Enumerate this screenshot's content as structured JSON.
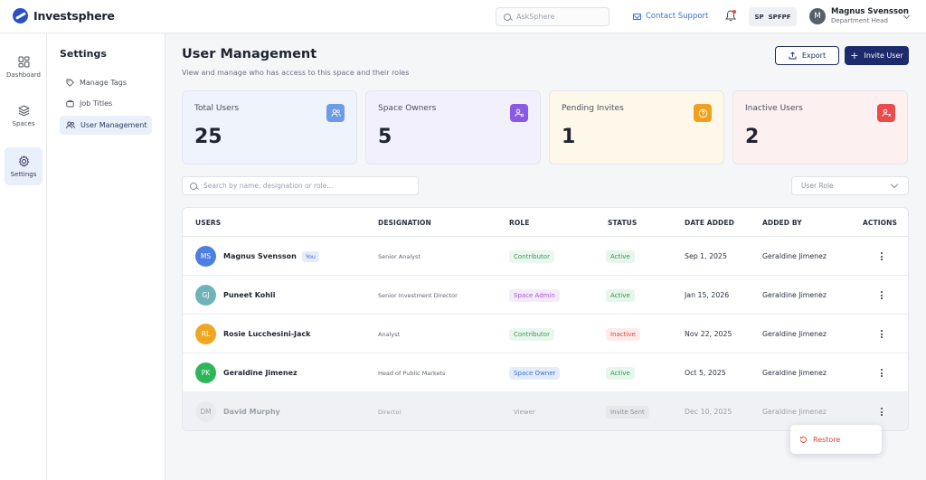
{
  "app": {
    "brand": "Investsphere",
    "ask_placeholder": "AskSphere",
    "support_label": "Contact Support",
    "workspace_initials": "SP",
    "workspace_code": "SPFPF",
    "user_initial": "M",
    "user_name": "Magnus Svensson",
    "user_role": "Department Head"
  },
  "rail": [
    {
      "label": "Dashboard",
      "icon": "grid-icon"
    },
    {
      "label": "Spaces",
      "icon": "layers-icon"
    },
    {
      "label": "Settings",
      "icon": "gear-icon",
      "active": true
    }
  ],
  "subnav": {
    "title": "Settings",
    "items": [
      {
        "label": "Manage Tags",
        "icon": "tag-icon"
      },
      {
        "label": "Job Titles",
        "icon": "briefcase-icon"
      },
      {
        "label": "User Management",
        "icon": "users-icon",
        "active": true
      }
    ]
  },
  "page": {
    "title": "User Management",
    "subtitle": "View and manage  who has access to this space and their roles",
    "export_label": "Export",
    "invite_label": "Invite User"
  },
  "stats": [
    {
      "label": "Total Users",
      "value": "25",
      "bg": "#eef3fc",
      "icon_bg": "#6e9be6",
      "icon": "users-icon"
    },
    {
      "label": "Space Owners",
      "value": "5",
      "bg": "#f3f0fd",
      "icon_bg": "#8a5ae6",
      "icon": "user-cog-icon"
    },
    {
      "label": "Pending Invites",
      "value": "1",
      "bg": "#fdf8ea",
      "icon_bg": "#f0a01f",
      "icon": "question-icon"
    },
    {
      "label": "Inactive Users",
      "value": "2",
      "bg": "#fdf0f0",
      "icon_bg": "#ea4b4b",
      "icon": "user-x-icon"
    }
  ],
  "filters": {
    "search_placeholder": "Search by name, designation or role...",
    "role_placeholder": "User Role"
  },
  "table": {
    "headers": [
      "USERS",
      "DESIGNATION",
      "ROLE",
      "STATUS",
      "DATE ADDED",
      "ADDED BY",
      "ACTIONS"
    ],
    "rows": [
      {
        "initials": "MS",
        "avatar_color": "#4d7fe0",
        "name": "Magnus Svensson",
        "you": "You",
        "designation": "Senior Analyst",
        "role": "Contributor",
        "role_bg": "#eaf7ee",
        "role_fg": "#3a9a57",
        "status": "Active",
        "status_bg": "#e6f6ea",
        "status_fg": "#2f9a4e",
        "date": "Sep 1, 2025",
        "added_by": "Geraldine Jimenez"
      },
      {
        "initials": "GJ",
        "avatar_color": "#6fb3b8",
        "name": "Puneet Kohli",
        "you": "",
        "designation": "Senior Investment Director",
        "role": "Space Admin",
        "role_bg": "#f4ebfb",
        "role_fg": "#a45ad6",
        "status": "Active",
        "status_bg": "#e6f6ea",
        "status_fg": "#2f9a4e",
        "date": "Jan 15, 2026",
        "added_by": "Geraldine Jimenez"
      },
      {
        "initials": "RL",
        "avatar_color": "#f0a71f",
        "name": "Rosie Lucchesini-Jack",
        "you": "",
        "designation": "Analyst",
        "role": "Contributor",
        "role_bg": "#eaf7ee",
        "role_fg": "#3a9a57",
        "status": "Inactive",
        "status_bg": "#fdeceb",
        "status_fg": "#d9463b",
        "date": "Nov 22, 2025",
        "added_by": "Geraldine Jimenez"
      },
      {
        "initials": "PK",
        "avatar_color": "#2fb55a",
        "name": "Geraldine Jimenez",
        "you": "",
        "designation": "Head of Public Markets",
        "role": "Space Owner",
        "role_bg": "#e3ecfb",
        "role_fg": "#3a6fd0",
        "status": "Active",
        "status_bg": "#e6f6ea",
        "status_fg": "#2f9a4e",
        "date": "Oct 5, 2025",
        "added_by": "Geraldine Jimenez"
      },
      {
        "initials": "DM",
        "avatar_color": "#e9eaee",
        "name": "David Murphy",
        "you": "",
        "designation": "Director",
        "role": "Viewer",
        "role_bg": "transparent",
        "role_fg": "#9aa0ab",
        "status": "Invite Sent",
        "status_bg": "#e6e8ec",
        "status_fg": "#8a909c",
        "date": "Dec 10, 2025",
        "added_by": "Geraldine Jimenez",
        "dim": true
      }
    ]
  },
  "menu": {
    "restore_label": "Restore"
  }
}
